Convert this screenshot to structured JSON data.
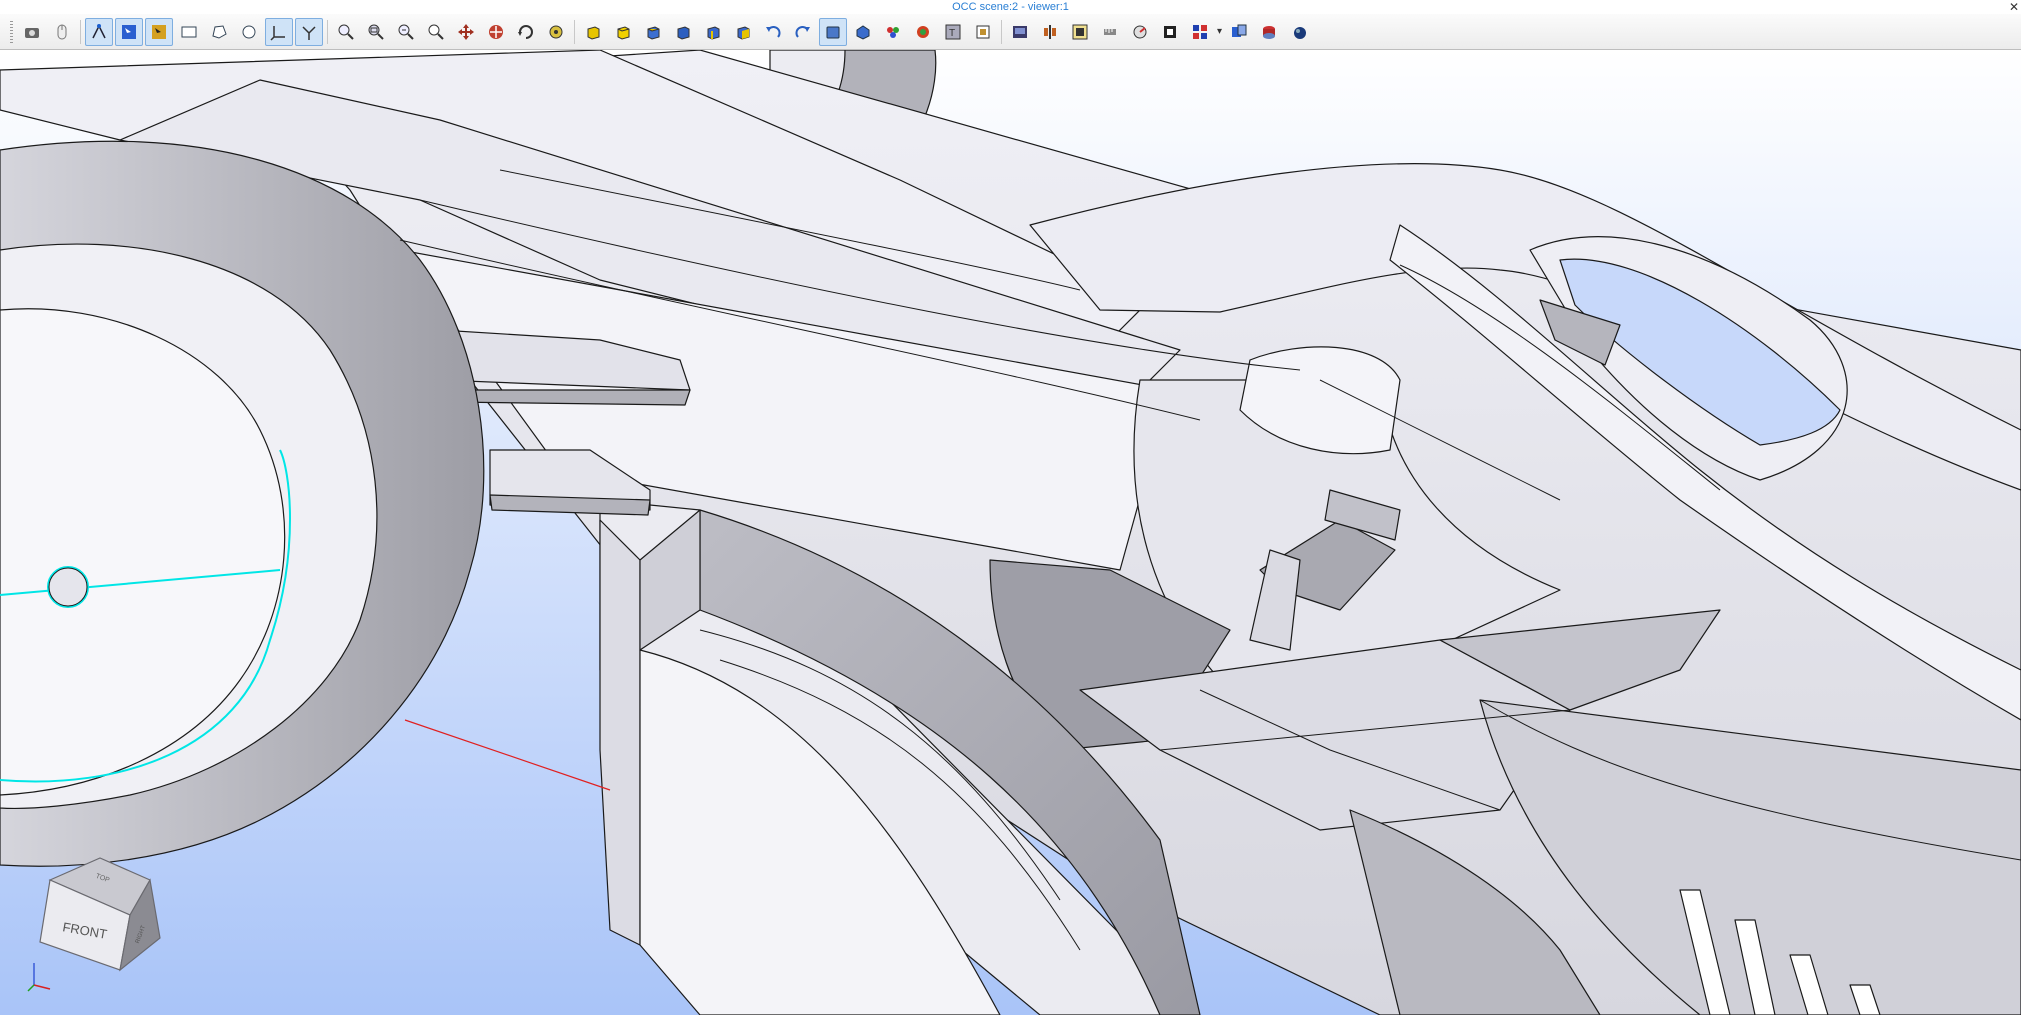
{
  "window": {
    "title": "OCC scene:2 - viewer:1",
    "close_glyph": "✕"
  },
  "toolbar": {
    "buttons": [
      {
        "icon": "camera-icon",
        "active": false
      },
      {
        "icon": "mouse-icon",
        "active": false
      },
      {
        "sep": true
      },
      {
        "icon": "select-vertex-icon",
        "active": true
      },
      {
        "icon": "select-edge-icon",
        "active": true
      },
      {
        "icon": "select-face-icon",
        "active": true
      },
      {
        "icon": "rectangle-select-icon",
        "active": false
      },
      {
        "icon": "polygon-select-icon",
        "active": false
      },
      {
        "icon": "circle-select-icon",
        "active": false
      },
      {
        "icon": "axes-icon",
        "active": true
      },
      {
        "icon": "trihedron-icon",
        "active": true
      },
      {
        "sep": true
      },
      {
        "icon": "zoom-icon",
        "active": false
      },
      {
        "icon": "zoom-window-icon",
        "active": false
      },
      {
        "icon": "zoom-fit-icon",
        "active": false
      },
      {
        "icon": "zoom-out-icon",
        "active": false
      },
      {
        "icon": "pan-icon",
        "active": false
      },
      {
        "icon": "global-pan-icon",
        "active": false
      },
      {
        "icon": "rotate-icon",
        "active": false
      },
      {
        "icon": "reset-view-icon",
        "active": false
      },
      {
        "sep": true
      },
      {
        "icon": "view-front-icon",
        "active": false
      },
      {
        "icon": "view-back-icon",
        "active": false
      },
      {
        "icon": "view-top-icon",
        "active": false
      },
      {
        "icon": "view-bottom-icon",
        "active": false
      },
      {
        "icon": "view-left-icon",
        "active": false
      },
      {
        "icon": "view-right-icon",
        "active": false
      },
      {
        "icon": "undo-icon",
        "active": false
      },
      {
        "icon": "redo-icon",
        "active": false
      },
      {
        "icon": "shaded-mode-icon",
        "active": true
      },
      {
        "icon": "wireframe-mode-icon",
        "active": false
      },
      {
        "icon": "color-icon",
        "active": false
      },
      {
        "icon": "material-icon",
        "active": false
      },
      {
        "icon": "transparency-icon",
        "active": false
      },
      {
        "icon": "hidden-line-icon",
        "active": false
      },
      {
        "sep": true
      },
      {
        "icon": "dump-view-icon",
        "active": false
      },
      {
        "icon": "clipping-icon",
        "active": false
      },
      {
        "icon": "explode-icon",
        "active": false
      },
      {
        "icon": "measure-icon",
        "active": false
      },
      {
        "icon": "graduated-trihedron-icon",
        "active": false
      },
      {
        "icon": "environment-icon",
        "active": false
      },
      {
        "icon": "settings-dropdown-icon",
        "active": false,
        "dropdown": true
      },
      {
        "icon": "sync-icon",
        "active": false
      },
      {
        "icon": "ray-tracing-icon",
        "active": false
      },
      {
        "icon": "sphere-render-icon",
        "active": false
      }
    ]
  },
  "viewport": {
    "background_top": "#ffffff",
    "background_bottom": "#a9c4f8",
    "model_color": "#e6e6ee",
    "edge_color": "#1a1a1a",
    "selection_color": "#00e6e6",
    "axis_color": "#e02020"
  },
  "viewcube": {
    "front_label": "FRONT",
    "top_label": "TOP",
    "side_label": "RIGHT"
  }
}
